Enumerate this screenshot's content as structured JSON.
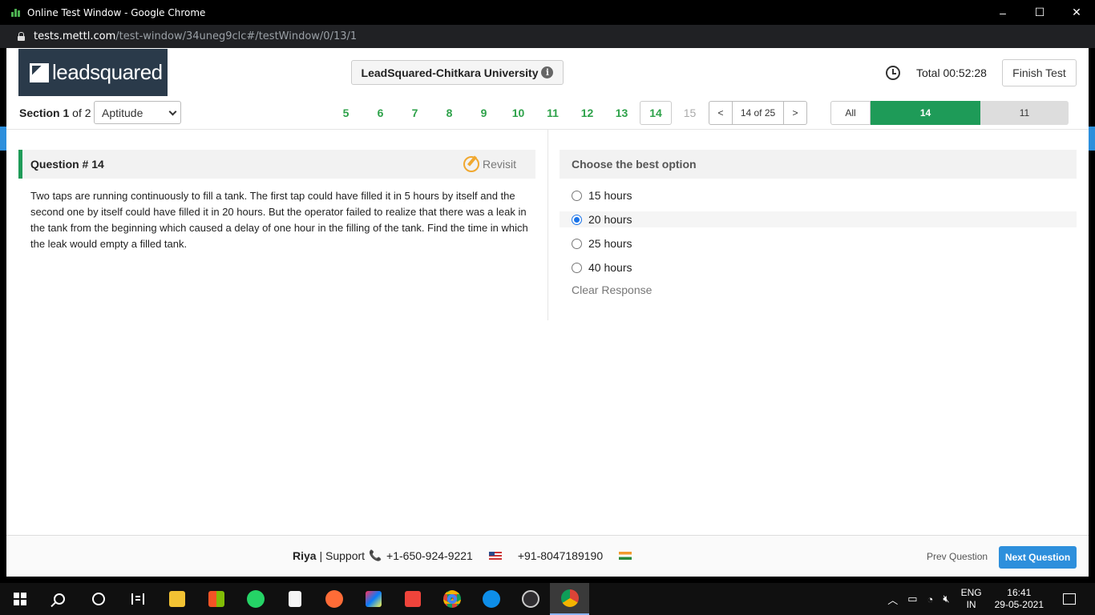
{
  "window": {
    "title": "Online Test Window - Google Chrome",
    "minimize": "–",
    "maximize": "☐",
    "close": "✕"
  },
  "address": {
    "host": "tests.mettl.com",
    "path": "/test-window/34uneg9clc#/testWindow/0/13/1"
  },
  "header": {
    "logo_text": "leadsquared",
    "test_name": "LeadSquared-Chitkara University",
    "info_glyph": "i",
    "timer": "Total 00:52:28",
    "finish_label": "Finish Test"
  },
  "nav": {
    "section_word": "Section",
    "section_num": "1",
    "section_of": "of 2",
    "section_select": "Aptitude",
    "question_numbers": [
      {
        "n": "5",
        "state": "answered"
      },
      {
        "n": "6",
        "state": "answered"
      },
      {
        "n": "7",
        "state": "answered"
      },
      {
        "n": "8",
        "state": "answered"
      },
      {
        "n": "9",
        "state": "answered"
      },
      {
        "n": "10",
        "state": "answered"
      },
      {
        "n": "11",
        "state": "answered"
      },
      {
        "n": "12",
        "state": "answered"
      },
      {
        "n": "13",
        "state": "answered"
      },
      {
        "n": "14",
        "state": "current"
      },
      {
        "n": "15",
        "state": "unvisited"
      }
    ],
    "pager_prev": "<",
    "pager_position": "14 of 25",
    "pager_next": ">",
    "filter_all": "All",
    "filter_answered": "14",
    "filter_unanswered": "11"
  },
  "question": {
    "title": "Question # 14",
    "revisit_label": "Revisit",
    "text": "Two taps are running continuously to fill a tank. The first tap could have filled it in 5 hours by itself and the second one by itself could have filled it in 20 hours. But the operator failed to realize that there was a leak in the tank from the beginning which caused a delay of one hour in the filling of the tank. Find the time in which the leak would empty a filled tank."
  },
  "answers": {
    "heading": "Choose the best option",
    "options": [
      {
        "label": "15 hours",
        "selected": false
      },
      {
        "label": "20 hours",
        "selected": true
      },
      {
        "label": "25 hours",
        "selected": false
      },
      {
        "label": "40 hours",
        "selected": false
      }
    ],
    "clear_label": "Clear Response"
  },
  "footer": {
    "user": "Riya",
    "support_label": "| Support",
    "phone_us": "+1-650-924-9221",
    "phone_in": "+91-8047189190",
    "prev_label": "Prev Question",
    "next_label": "Next Question"
  },
  "taskbar": {
    "lang_top": "ENG",
    "lang_bottom": "IN",
    "time": "16:41",
    "date": "29-05-2021"
  },
  "colors": {
    "accent_green": "#1e9b58",
    "accent_blue": "#2d8fdc",
    "logo_bg": "#2a3a4a"
  }
}
